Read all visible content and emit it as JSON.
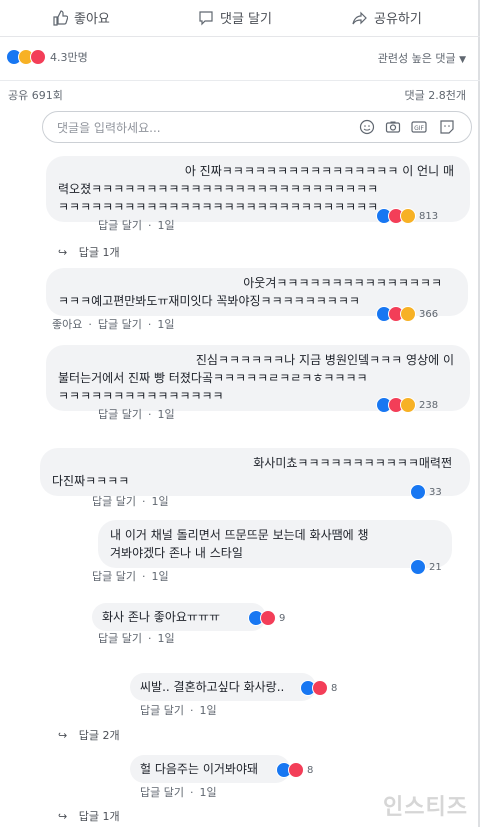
{
  "actions": {
    "like": "좋아요",
    "comment": "댓글 달기",
    "share": "공유하기"
  },
  "reactions": {
    "count": "4.3만명"
  },
  "sort": {
    "label": "관련성 높은 댓글"
  },
  "shares": {
    "label": "공유 691회"
  },
  "comments_count": {
    "label": "댓글 2.8천개"
  },
  "input": {
    "placeholder": "댓글을 입력하세요..."
  },
  "common": {
    "reply": "답글 달기",
    "time": "1일",
    "like": "좋아요",
    "dot": "·"
  },
  "comments": [
    {
      "lines": [
        "아 진짜ㅋㅋㅋㅋㅋㅋㅋㅋㅋㅋㅋㅋㅋㅋㅋㅋ 이 언니 매",
        "력오졌ㅋㅋㅋㅋㅋㅋㅋㅋㅋㅋㅋㅋㅋㅋㅋㅋㅋㅋㅋㅋㅋㅋㅋㅋㅋㅋ",
        "ㅋㅋㅋㅋㅋㅋㅋㅋㅋㅋㅋㅋㅋㅋㅋㅋㅋㅋㅋㅋㅋㅋㅋㅋㅋㅋㅋㅋㅋ"
      ],
      "count": "813",
      "replies": "답글 1개"
    },
    {
      "lines": [
        "아웃겨ㅋㅋㅋㅋㅋㅋㅋㅋㅋㅋㅋㅋㅋㅋㅋ",
        "ㅋㅋㅋ예고편만봐도ㅠ재미잇다 꼭봐야징ㅋㅋㅋㅋㅋㅋㅋㅋㅋ"
      ],
      "count": "366"
    },
    {
      "lines": [
        "진심ㅋㅋㅋㅋㅋㅋ나 지금 병원인뎈ㅋㅋㅋ 영상에 이",
        "불터는거에서 진짜 빵 터졌다곸ㅋㅋㅋㅋㅋㄹㅋㄹㅋㅎㅋㅋㅋㅋ",
        "ㅋㅋㅋㅋㅋㅋㅋㅋㅋㅋㅋㅋㅋㅋㅋ"
      ],
      "count": "238"
    },
    {
      "lines": [
        "화사미쵸ㅋㅋㅋㅋㅋㅋㅋㅋㅋㅋㅋ매력쩐",
        "다진짜ㅋㅋㅋㅋ"
      ],
      "count": "33"
    },
    {
      "lines": [
        "내 이거 채널 돌리면서 뜨문뜨문 보는데 화사땜에 챙",
        "겨봐야겠다 존나 내 스타일"
      ],
      "count": "21"
    },
    {
      "lines": [
        "화사 존나 좋아요ㅠㅠㅠ"
      ],
      "count": "9"
    },
    {
      "lines": [
        "씨발.. 결혼하고싶다 화사랑.."
      ],
      "count": "8",
      "replies": "답글 2개"
    },
    {
      "lines": [
        "헐 다음주는 이거봐야돼"
      ],
      "count": "8",
      "replies": "답글 1개"
    }
  ],
  "watermark": "인스티즈",
  "colors": {
    "like": "#1877f2",
    "love": "#f33e58",
    "haha": "#f7b125"
  }
}
